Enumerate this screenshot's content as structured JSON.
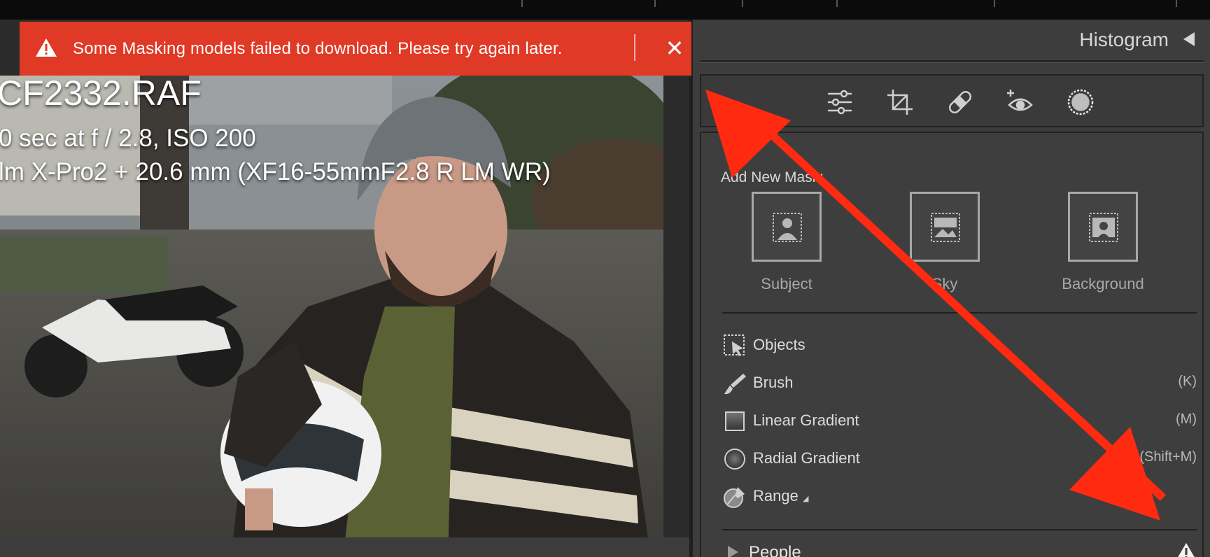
{
  "notification": {
    "message": "Some Masking models failed to download. Please try again later.",
    "close_symbol": "✕",
    "color": "#e03a26"
  },
  "photo_info": {
    "filename": "CF2332.RAF",
    "exposure": "0 sec at f / 2.8, ISO 200",
    "camera": "lm X-Pro2 + 20.6 mm (XF16-55mmF2.8 R LM WR)"
  },
  "histogram": {
    "label": "Histogram"
  },
  "tools": [
    {
      "icon": "sliders-icon"
    },
    {
      "icon": "crop-icon"
    },
    {
      "icon": "bandage-icon"
    },
    {
      "icon": "red-eye-icon"
    },
    {
      "icon": "masking-icon"
    }
  ],
  "masking": {
    "add_mask_label": "Add New Mask:",
    "buttons": [
      {
        "label": "Subject",
        "icon": "subject-icon"
      },
      {
        "label": "Sky",
        "icon": "sky-icon"
      },
      {
        "label": "Background",
        "icon": "background-icon"
      }
    ],
    "items": [
      {
        "label": "Objects",
        "shortcut": "",
        "icon": "objects-icon"
      },
      {
        "label": "Brush",
        "shortcut": "(K)",
        "icon": "brush-icon"
      },
      {
        "label": "Linear Gradient",
        "shortcut": "(M)",
        "icon": "linear-gradient-icon"
      },
      {
        "label": "Radial Gradient",
        "shortcut": "(Shift+M)",
        "icon": "radial-gradient-icon"
      },
      {
        "label": "Range",
        "shortcut": "",
        "icon": "range-icon"
      }
    ],
    "people_label": "People"
  },
  "accent_arrow_color": "#ff2a10"
}
